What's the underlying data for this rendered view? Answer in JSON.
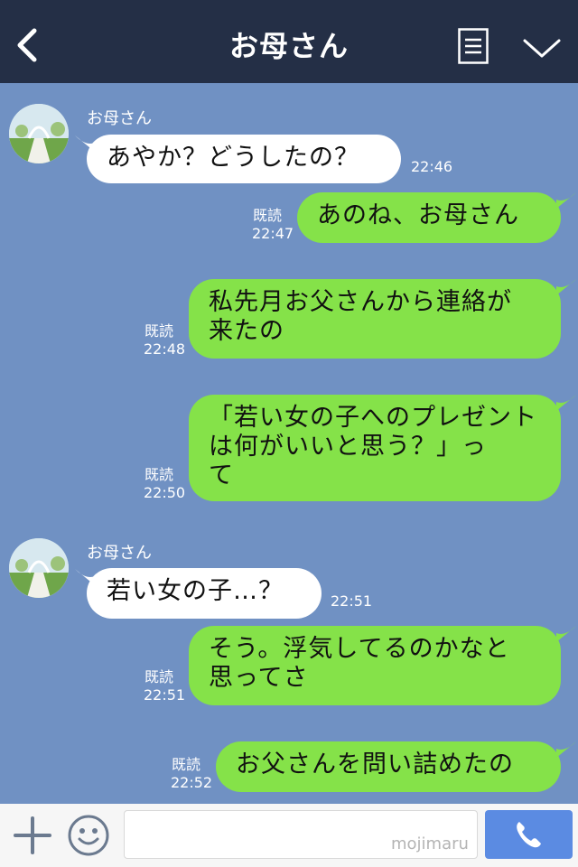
{
  "header": {
    "title": "お母さん",
    "back_icon": "chevron-left-icon",
    "menu_icon": "menu-icon",
    "dropdown_icon": "chevron-down-icon"
  },
  "messages": [
    {
      "side": "in",
      "sender": "お母さん",
      "text": "あやか？どうしたの？",
      "time": "22:46"
    },
    {
      "side": "out",
      "read": "既読",
      "text": "あのね、お母さん",
      "time": "22:47"
    },
    {
      "side": "out",
      "read": "既読",
      "lines": [
        "私先月お父さんから連絡が",
        "来たの"
      ],
      "time": "22:48"
    },
    {
      "side": "out",
      "read": "既読",
      "lines": [
        "「若い女の子へのプレゼント",
        "は何がいいと思う？」っ",
        "て"
      ],
      "time": "22:50"
    },
    {
      "side": "in",
      "sender": "お母さん",
      "text": "若い女の子…？",
      "time": "22:51"
    },
    {
      "side": "out",
      "read": "既読",
      "lines": [
        "そう。浮気してるのかなと",
        "思ってさ"
      ],
      "time": "22:51"
    },
    {
      "side": "out",
      "read": "既読",
      "text": "お父さんを問い詰めたの",
      "time": "22:52"
    }
  ],
  "input": {
    "placeholder": "",
    "watermark": "mojimaru"
  },
  "icons": {
    "add": "plus-icon",
    "emoji": "smile-icon",
    "send": "phone-icon"
  },
  "colors": {
    "header_bg": "#242f46",
    "chat_bg": "#7091c3",
    "outgoing_bubble": "#85e249",
    "incoming_bubble": "#ffffff",
    "send_button": "#5b8be2"
  }
}
